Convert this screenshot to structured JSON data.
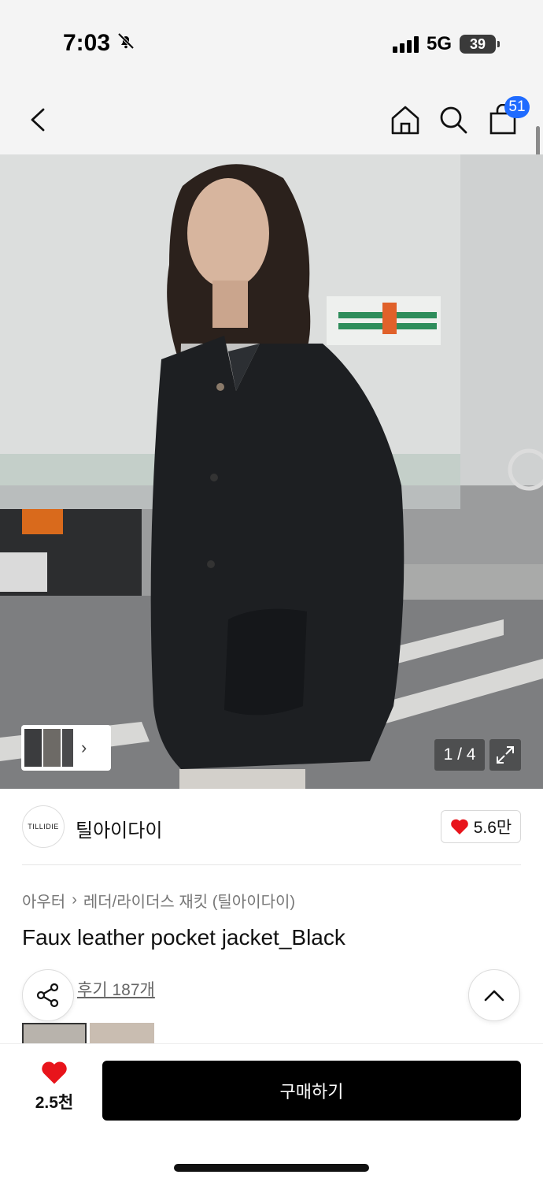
{
  "status_bar": {
    "time": "7:03",
    "network": "5G",
    "battery": "39"
  },
  "header": {
    "cart_count": "51"
  },
  "gallery": {
    "page_counter": "1 / 4"
  },
  "brand": {
    "logo_text": "TILLIDIE",
    "name": "틸아이다이",
    "likes": "5.6만"
  },
  "product": {
    "breadcrumb": [
      "아우터",
      "레더/라이더스 재킷 (틸아이다이)"
    ],
    "title": "Faux leather pocket jacket_Black",
    "reviews": "후기 187개"
  },
  "bottom_bar": {
    "wish_count": "2.5천",
    "buy_label": "구매하기"
  },
  "colors": {
    "accent_badge": "#1f6bff",
    "heart": "#e8141b",
    "buy_button": "#000000"
  },
  "icons": [
    "bell-muted-icon",
    "back-arrow-icon",
    "home-icon",
    "search-icon",
    "shopping-bag-icon",
    "chevron-right-icon",
    "expand-icon",
    "heart-icon",
    "share-icon",
    "chevron-up-icon"
  ]
}
